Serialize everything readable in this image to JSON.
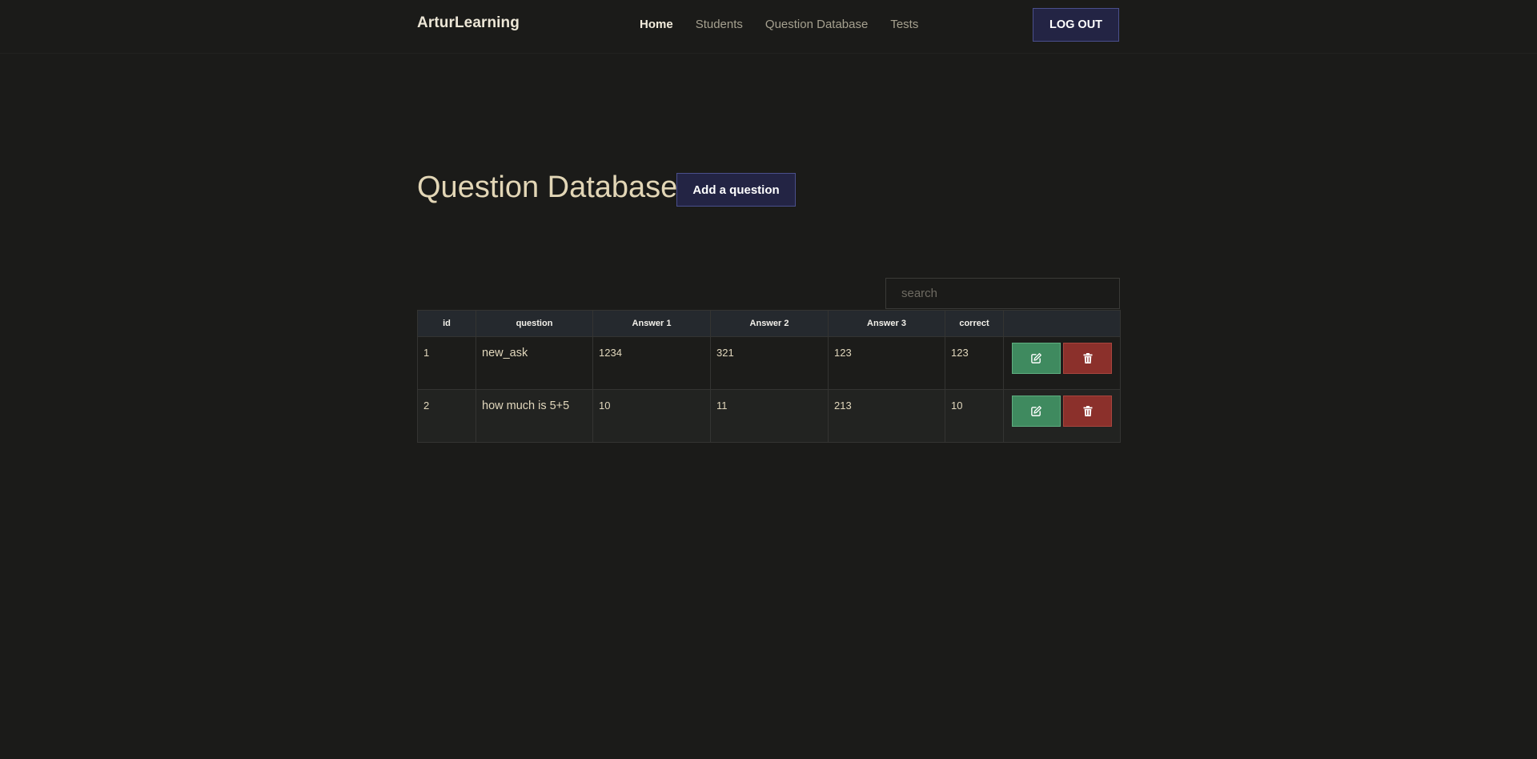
{
  "navbar": {
    "brand": "ArturLearning",
    "links": [
      {
        "label": "Home",
        "active": true
      },
      {
        "label": "Students",
        "active": false
      },
      {
        "label": "Question Database",
        "active": false
      },
      {
        "label": "Tests",
        "active": false
      }
    ],
    "logout_label": "LOG OUT"
  },
  "page": {
    "title": "Question Database",
    "add_button_label": "Add a question"
  },
  "search": {
    "placeholder": "search",
    "value": ""
  },
  "table": {
    "headers": [
      "id",
      "question",
      "Answer 1",
      "Answer 2",
      "Answer 3",
      "correct",
      ""
    ],
    "rows": [
      {
        "id": "1",
        "question": "new_ask",
        "answer1": "1234",
        "answer2": "321",
        "answer3": "123",
        "correct": "123"
      },
      {
        "id": "2",
        "question": "how much is 5+5",
        "answer1": "10",
        "answer2": "11",
        "answer3": "213",
        "correct": "10"
      }
    ],
    "row_actions": [
      "edit-icon",
      "trash-icon"
    ]
  },
  "colors": {
    "background": "#1b1b19",
    "primary_button": "#232444",
    "edit_button": "#3f8a5f",
    "delete_button": "#8b302b",
    "title_text": "#e2d6b6"
  }
}
